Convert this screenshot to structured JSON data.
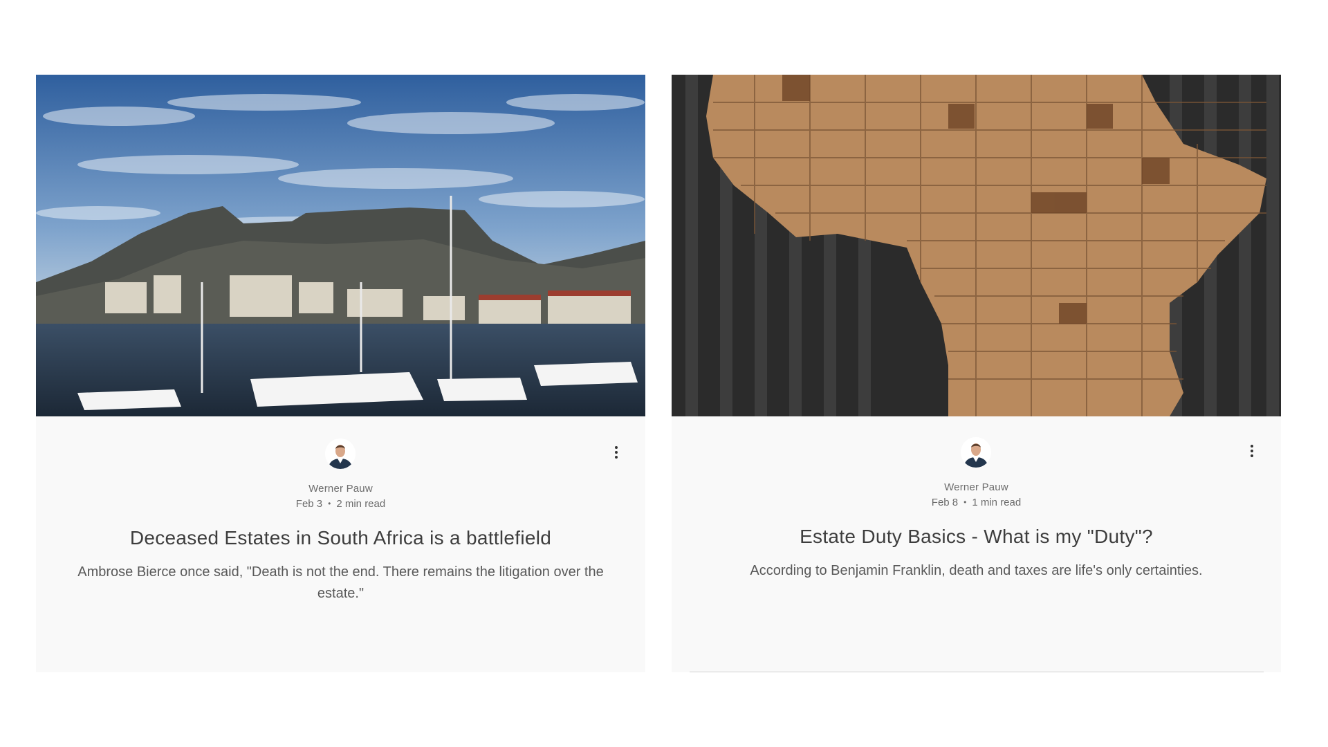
{
  "posts": [
    {
      "image_alt": "Cape Town harbour with Table Mountain",
      "author": "Werner Pauw",
      "date": "Feb 3",
      "read_time": "2 min read",
      "title": "Deceased Estates in South Africa is a battlefield",
      "excerpt": "Ambrose Bierce once said, \"Death is not the end. There remains the litigation over the estate.\"",
      "more_icon": "more-vertical-icon"
    },
    {
      "image_alt": "Wooden map of Africa",
      "author": "Werner Pauw",
      "date": "Feb 8",
      "read_time": "1 min read",
      "title": "Estate Duty Basics - What is my \"Duty\"?",
      "excerpt": "According to Benjamin Franklin, death and taxes are life's only certainties.",
      "more_icon": "more-vertical-icon"
    }
  ],
  "dot_separator": "•",
  "colors": {
    "card_background": "#f9f9f9",
    "title_text": "#3d3d3d",
    "meta_text": "#6b6b6b",
    "excerpt_text": "#595959"
  }
}
